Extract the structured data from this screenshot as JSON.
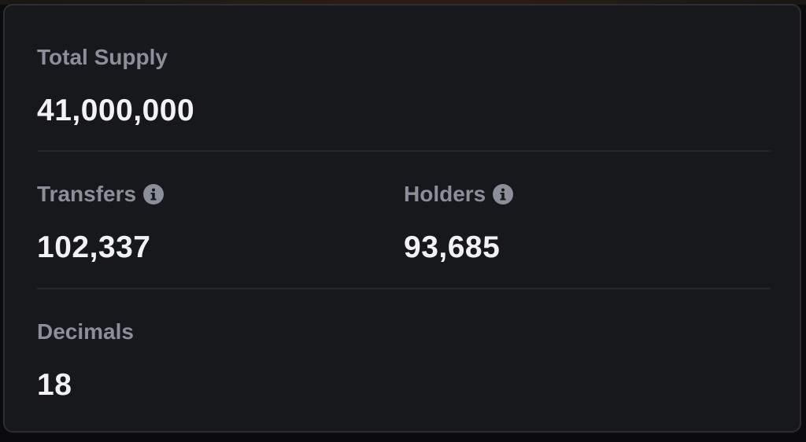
{
  "card": {
    "total_supply": {
      "label": "Total Supply",
      "value": "41,000,000"
    },
    "transfers": {
      "label": "Transfers",
      "value": "102,337",
      "icon": "info-icon"
    },
    "holders": {
      "label": "Holders",
      "value": "93,685",
      "icon": "info-icon"
    },
    "decimals": {
      "label": "Decimals",
      "value": "18"
    }
  },
  "colors": {
    "background": "#17181b",
    "border": "#2c2e33",
    "label": "#8b8f9a",
    "value": "#f2f2f4",
    "divider": "#24262b"
  }
}
